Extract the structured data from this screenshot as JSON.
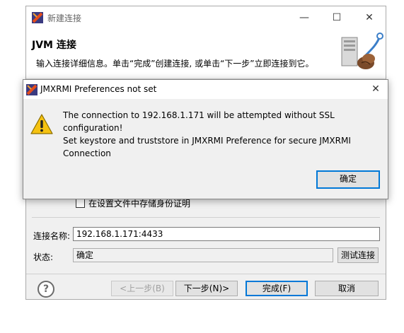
{
  "wizard": {
    "title": "新建连接",
    "heading": "JVM 连接",
    "description": "输入连接详细信息。单击“完成”创建连接, 或单击“下一步”立即连接到它。",
    "save_credentials_label": "在设置文件中存储身份证明",
    "connection_name_label": "连接名称:",
    "connection_name_value": "192.168.1.171:4433",
    "status_label": "状态:",
    "status_value": "确定",
    "test_connection_label": "测试连接",
    "back_label": "<上一步(B)",
    "next_label": "下一步(N)>",
    "finish_label": "完成(F)",
    "cancel_label": "取消",
    "help_symbol": "?"
  },
  "dialog": {
    "title": "JMXRMI Preferences not set",
    "message_line1": "The connection to 192.168.1.171 will be attempted without SSL configuration!",
    "message_line2": "Set keystore and truststore in JMXRMI Preference for secure JMXRMI",
    "message_line3": "Connection",
    "ok_label": "确定"
  },
  "window_controls": {
    "minimize": "—",
    "maximize": "☐",
    "close": "✕"
  },
  "colors": {
    "accent": "#0078d7",
    "dialog_bg": "#f0f0f0",
    "warning": "#f5c211"
  }
}
